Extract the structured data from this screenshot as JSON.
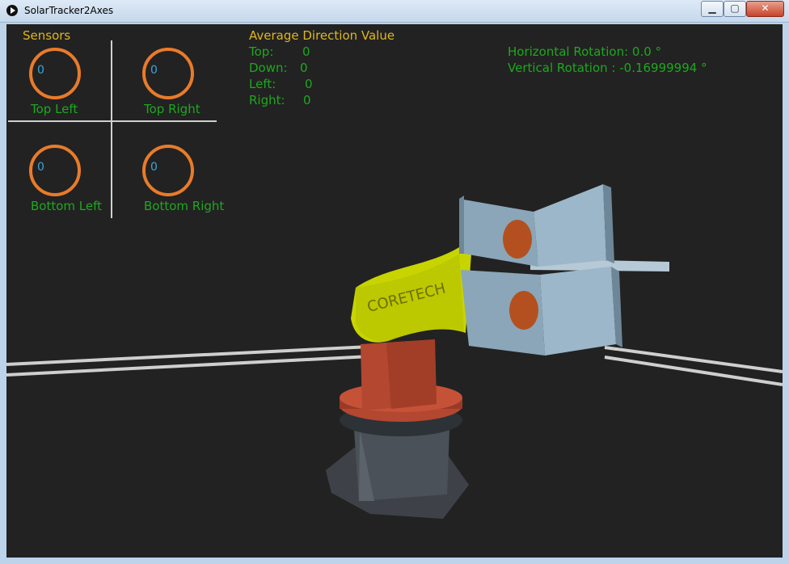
{
  "window": {
    "title": "SolarTracker2Axes",
    "min_symbol": "▁",
    "max_symbol": "▢",
    "close_symbol": "✕"
  },
  "sensors": {
    "title": "Sensors",
    "items": [
      {
        "label": "Top Left",
        "value": "0"
      },
      {
        "label": "Top Right",
        "value": "0"
      },
      {
        "label": "Bottom Left",
        "value": "0"
      },
      {
        "label": "Bottom Right",
        "value": "0"
      }
    ]
  },
  "average": {
    "title": "Average Direction Value",
    "rows": [
      {
        "label": "Top:",
        "value": "0"
      },
      {
        "label": "Down:",
        "value": "0"
      },
      {
        "label": "Left:",
        "value": "0"
      },
      {
        "label": "Right:",
        "value": "0"
      }
    ]
  },
  "rotation": {
    "horizontal": "Horizontal Rotation: 0.0 °",
    "vertical": "Vertical Rotation : -0.16999994 °"
  },
  "model": {
    "brand_text": "CORETECH"
  },
  "colors": {
    "background": "#222222",
    "accent_orange": "#e97b2a",
    "label_green": "#1ea81e",
    "title_yellow": "#e1b61d",
    "value_cyan": "#3aa6d8",
    "arm_yellow": "#c8d400",
    "base_red": "#b3472f",
    "panel_blue": "#8aa6b8"
  }
}
